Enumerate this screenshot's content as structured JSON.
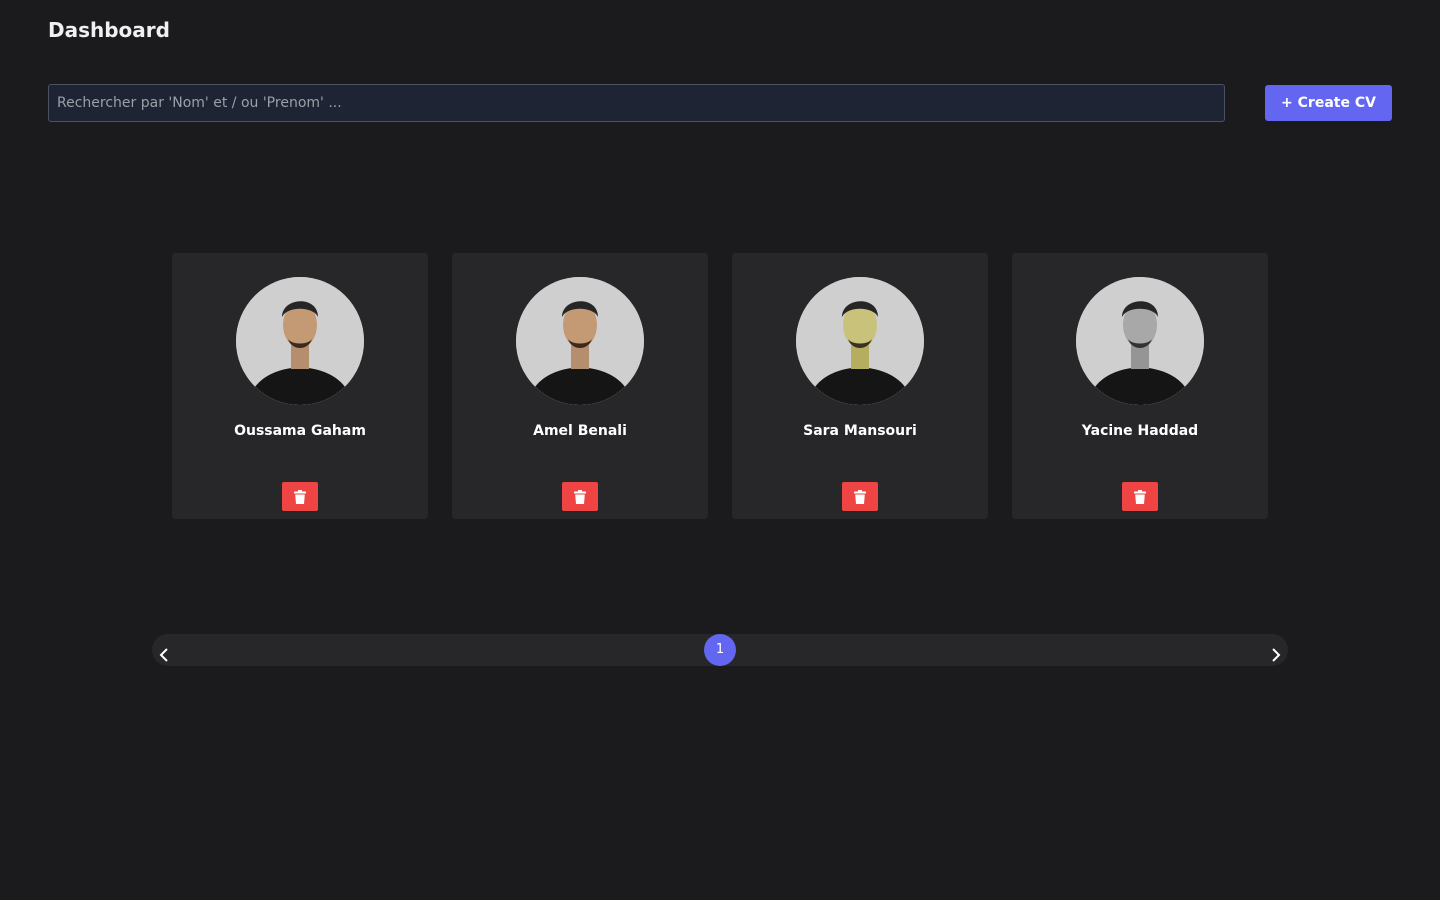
{
  "header": {
    "title": "Dashboard"
  },
  "search": {
    "placeholder": "Rechercher par 'Nom' et / ou 'Prenom' ...",
    "value": ""
  },
  "actions": {
    "create_label": "+ Create CV"
  },
  "cards": [
    {
      "name": "Oussama Gaham",
      "avatar_tint": "#d2b48c"
    },
    {
      "name": "Amel Benali",
      "avatar_tint": "#d2b48c"
    },
    {
      "name": "Sara Mansouri",
      "avatar_tint": "#c9c27a"
    },
    {
      "name": "Yacine Haddad",
      "avatar_tint": "#a8a8a8"
    }
  ],
  "pagination": {
    "current_page": "1"
  },
  "colors": {
    "background": "#1b1b1e",
    "card": "#27272a",
    "accent": "#6366f1",
    "danger": "#ef4444"
  },
  "icons": {
    "delete": "trash-icon",
    "prev": "chevron-left-icon",
    "next": "chevron-right-icon"
  }
}
